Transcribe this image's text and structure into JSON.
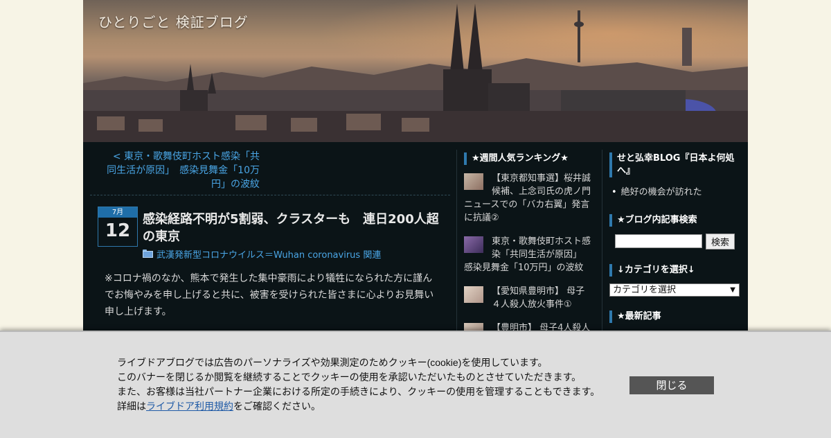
{
  "header": {
    "blog_title": "ひとりごと 検証ブログ"
  },
  "nav": {
    "prev_post_label": "< 東京・歌舞伎町ホスト感染「共同生活が原因」　感染見舞金「10万円」の波紋"
  },
  "post": {
    "date_month": "7月",
    "date_day": "12",
    "title": "感染経路不明が5割弱、クラスターも　連日200人超の東京",
    "category": "武漢発新型コロナウイルス＝Wuhan coronavirus 関連",
    "body": "※コロナ禍のなか、熊本で発生した集中豪雨により犠牲になられた方に謹んでお悔やみを申し上げると共に、被害を受けられた皆さまに心よりお見舞い申し上げます。"
  },
  "ranking": {
    "heading": "★週間人気ランキング★",
    "items": [
      "【東京都知事選】桜井誠候補、上念司氏の虎ノ門ニュースでの「バカ右翼」発言に抗議②",
      "東京・歌舞伎町ホスト感染「共同生活が原因」　感染見舞金「10万円」の波紋",
      "【愛知県豊明市】 母子４人殺人放火事件①",
      "【豊明市】 母子4人殺人"
    ]
  },
  "right_sidebar": {
    "blog_heading": "せと弘幸BLOG『日本よ何処へ』",
    "blog_link": "絶好の機会が訪れた",
    "search_heading": "★ブログ内記事検索",
    "search_button": "検索",
    "category_heading": "↓カテゴリを選択↓",
    "category_select": "カテゴリを選択",
    "latest_heading": "★最新記事"
  },
  "cookie": {
    "line1": "ライブドアブログでは広告のパーソナライズや効果測定のためクッキー(cookie)を使用しています。",
    "line2": "このバナーを閉じるか閲覧を継続することでクッキーの使用を承認いただいたものとさせていただきます。",
    "line3": "また、お客様は当社パートナー企業における所定の手続きにより、クッキーの使用を管理することもできます。",
    "line4_prefix": "詳細は",
    "line4_link": "ライブドア利用規約",
    "line4_suffix": "をご確認ください。",
    "close_label": "閉じる"
  }
}
